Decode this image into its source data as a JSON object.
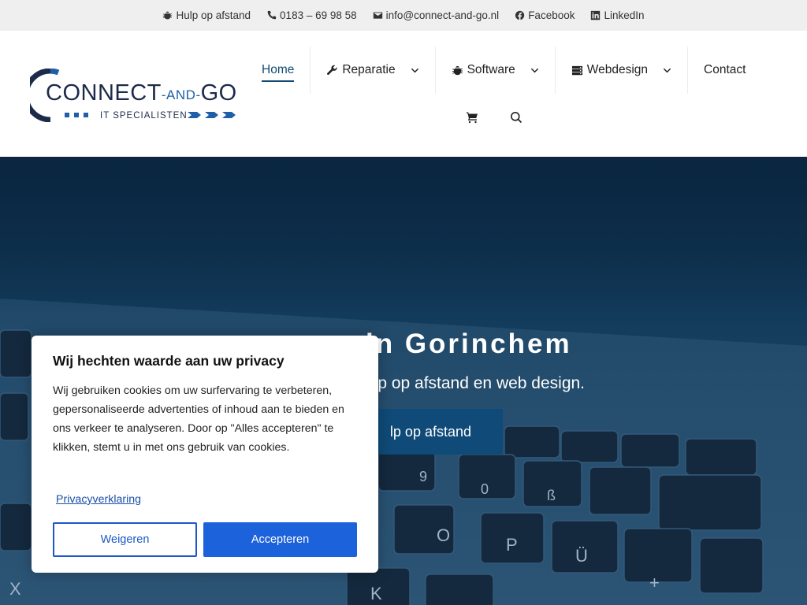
{
  "topbar": {
    "items": [
      {
        "icon": "bug-icon",
        "label": "Hulp op afstand"
      },
      {
        "icon": "phone-icon",
        "label": "0183 – 69 98 58"
      },
      {
        "icon": "envelope-icon",
        "label": "info@connect-and-go.nl"
      },
      {
        "icon": "facebook-icon",
        "label": "Facebook"
      },
      {
        "icon": "linkedin-icon",
        "label": "LinkedIn"
      }
    ]
  },
  "logo": {
    "main": "CONNECT",
    "mid": "-AND-",
    "end": "GO",
    "tagline": "IT SPECIALISTEN",
    "colors": {
      "dark": "#1d2b4a",
      "accent": "#1e5fa8"
    }
  },
  "nav": {
    "items": [
      {
        "label": "Home",
        "active": true
      },
      {
        "label": "Reparatie",
        "icon": "wrench-icon"
      },
      {
        "label": "Software",
        "icon": "bug-icon"
      },
      {
        "label": "Webdesign",
        "icon": "server-icon"
      },
      {
        "label": "Contact"
      }
    ],
    "icons": [
      "cart-icon",
      "search-icon"
    ]
  },
  "hero": {
    "title": "en in Gorinchem",
    "subtitle": "p, hulp op afstand en web design.",
    "button": "lp op afstand"
  },
  "cookie": {
    "title": "Wij hechten waarde aan uw privacy",
    "text": "Wij gebruiken cookies om uw surfervaring te verbeteren, gepersonaliseerde advertenties of inhoud aan te bieden en ons verkeer te analyseren. Door op \"Alles accepteren\" te klikken, stemt u in met ons gebruik van cookies.",
    "link": "Privacyverklaring",
    "deny": "Weigeren",
    "accept": "Accepteren"
  },
  "colors": {
    "primary": "#134a73",
    "cookie_button": "#1c62db"
  }
}
